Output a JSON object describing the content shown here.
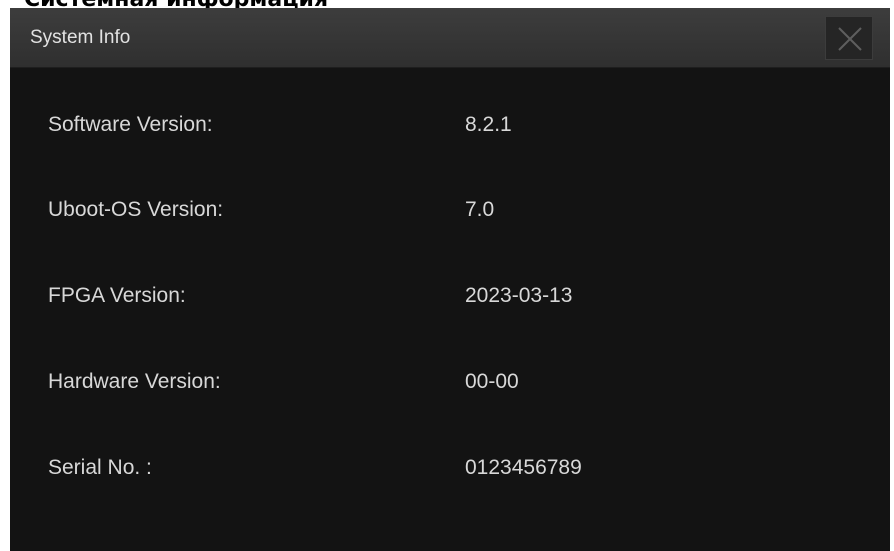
{
  "page": {
    "heading": "Системная информация"
  },
  "dialog": {
    "title": "System Info",
    "close_icon": "close-icon",
    "rows": [
      {
        "label": "Software Version:",
        "value": "8.2.1"
      },
      {
        "label": "Uboot-OS Version:",
        "value": "7.0"
      },
      {
        "label": "FPGA Version:",
        "value": "2023-03-13"
      },
      {
        "label": "Hardware Version:",
        "value": "00-00"
      },
      {
        "label": "Serial No. :",
        "value": "0123456789"
      }
    ]
  },
  "colors": {
    "dialog_background": "#131313",
    "titlebar_background": "#363636",
    "text": "#d8d8d8"
  }
}
